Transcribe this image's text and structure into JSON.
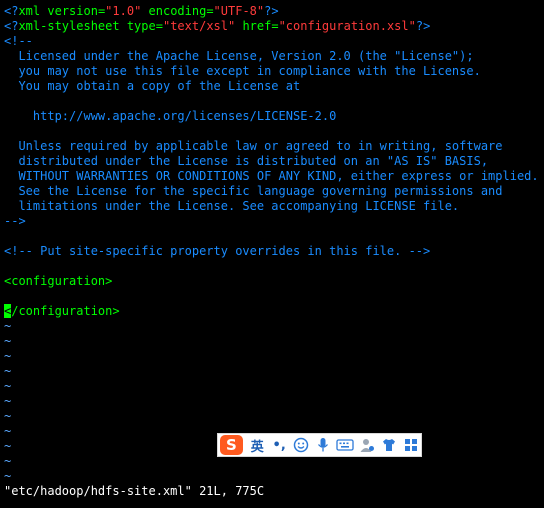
{
  "editor": {
    "lines": [
      [
        {
          "t": "<?",
          "c": "blue"
        },
        {
          "t": "xml",
          "c": "green"
        },
        {
          "t": " version=",
          "c": "green"
        },
        {
          "t": "\"1.0\"",
          "c": "red"
        },
        {
          "t": " encoding=",
          "c": "green"
        },
        {
          "t": "\"UTF-8\"",
          "c": "red"
        },
        {
          "t": "?>",
          "c": "blue"
        }
      ],
      [
        {
          "t": "<?",
          "c": "blue"
        },
        {
          "t": "xml-stylesheet",
          "c": "green"
        },
        {
          "t": " type=",
          "c": "green"
        },
        {
          "t": "\"text/xsl\"",
          "c": "red"
        },
        {
          "t": " href=",
          "c": "green"
        },
        {
          "t": "\"configuration.xsl\"",
          "c": "red"
        },
        {
          "t": "?>",
          "c": "blue"
        }
      ],
      [
        {
          "t": "<!--",
          "c": "blue"
        }
      ],
      [
        {
          "t": "  Licensed under the Apache License, Version 2.0 (the \"License\");",
          "c": "blue"
        }
      ],
      [
        {
          "t": "  you may not use this file except in compliance with the License.",
          "c": "blue"
        }
      ],
      [
        {
          "t": "  You may obtain a copy of the License at",
          "c": "blue"
        }
      ],
      [
        {
          "t": "",
          "c": "blue"
        }
      ],
      [
        {
          "t": "    http://www.apache.org/licenses/LICENSE-2.0",
          "c": "blue"
        }
      ],
      [
        {
          "t": "",
          "c": "blue"
        }
      ],
      [
        {
          "t": "  Unless required by applicable law or agreed to in writing, software",
          "c": "blue"
        }
      ],
      [
        {
          "t": "  distributed under the License is distributed on an \"AS IS\" BASIS,",
          "c": "blue"
        }
      ],
      [
        {
          "t": "  WITHOUT WARRANTIES OR CONDITIONS OF ANY KIND, either express or implied.",
          "c": "blue"
        }
      ],
      [
        {
          "t": "  See the License for the specific language governing permissions and",
          "c": "blue"
        }
      ],
      [
        {
          "t": "  limitations under the License. See accompanying LICENSE file.",
          "c": "blue"
        }
      ],
      [
        {
          "t": "-->",
          "c": "blue"
        }
      ],
      [
        {
          "t": "",
          "c": "blue"
        }
      ],
      [
        {
          "t": "<!-- Put site-specific property overrides in this file. -->",
          "c": "blue"
        }
      ],
      [
        {
          "t": "",
          "c": "blue"
        }
      ],
      [
        {
          "t": "<configuration>",
          "c": "green"
        }
      ],
      [
        {
          "t": "",
          "c": "blue"
        }
      ],
      [
        {
          "t": "<",
          "c": "cursor"
        },
        {
          "t": "/configuration>",
          "c": "green"
        }
      ],
      [
        {
          "t": "~",
          "c": "lightblue"
        }
      ],
      [
        {
          "t": "~",
          "c": "lightblue"
        }
      ],
      [
        {
          "t": "~",
          "c": "lightblue"
        }
      ],
      [
        {
          "t": "~",
          "c": "lightblue"
        }
      ],
      [
        {
          "t": "~",
          "c": "lightblue"
        }
      ],
      [
        {
          "t": "~",
          "c": "lightblue"
        }
      ],
      [
        {
          "t": "~",
          "c": "lightblue"
        }
      ],
      [
        {
          "t": "~",
          "c": "lightblue"
        }
      ],
      [
        {
          "t": "~",
          "c": "lightblue"
        }
      ],
      [
        {
          "t": "~",
          "c": "lightblue"
        }
      ],
      [
        {
          "t": "~",
          "c": "lightblue"
        }
      ]
    ],
    "status_line": "\"etc/hadoop/hdfs-site.xml\" 21L, 775C"
  },
  "ime_toolbar": {
    "logo": "S",
    "mode": "英",
    "punct": "•,",
    "icons": [
      "emoji-icon",
      "microphone-icon",
      "keyboard-icon",
      "user-icon",
      "skin-icon",
      "grid-menu-icon"
    ]
  },
  "colors": {
    "background": "#000000",
    "tag": "#00ff00",
    "comment": "#1a8cff",
    "string": "#ff3b3b",
    "tilde": "#5aa8ff",
    "cursor": "#00ff00",
    "ime_brand": "#ff5a1f"
  }
}
